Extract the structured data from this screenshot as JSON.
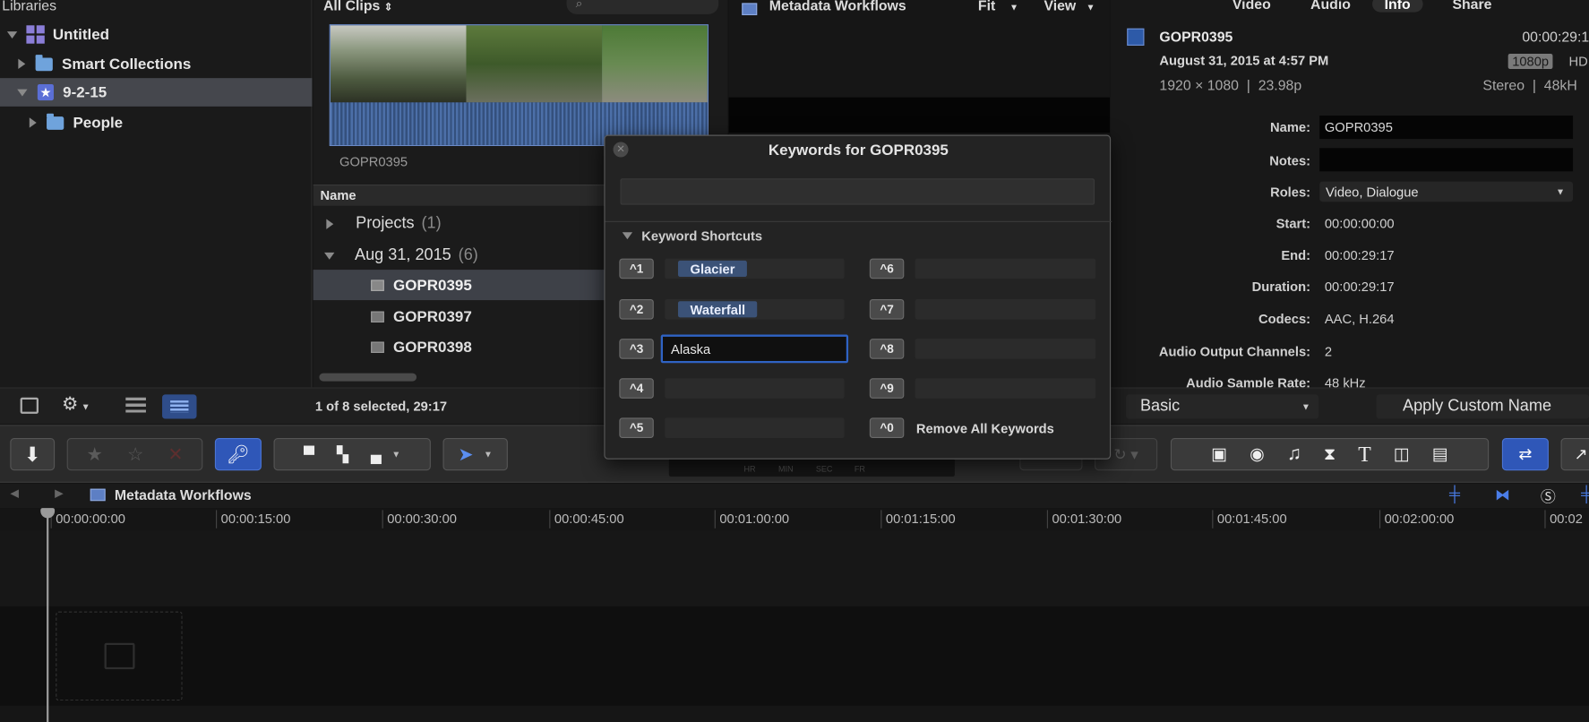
{
  "libraries": {
    "header": "Libraries",
    "items": [
      {
        "label": "Untitled"
      },
      {
        "label": "Smart Collections"
      },
      {
        "label": "9-2-15"
      },
      {
        "label": "People"
      }
    ]
  },
  "browser": {
    "filter": "All Clips",
    "filmstrip_label": "GOPR0395",
    "column_name": "Name",
    "rows": [
      {
        "label": "Projects",
        "count": "(1)"
      },
      {
        "label": "Aug 31, 2015",
        "count": "(6)"
      },
      {
        "label": "GOPR0395"
      },
      {
        "label": "GOPR0397"
      },
      {
        "label": "GOPR0398"
      }
    ],
    "status": "1 of 8 selected, 29:17"
  },
  "viewer": {
    "title": "Metadata Workflows",
    "fit": "Fit",
    "view": "View",
    "timecode_units": [
      "HR",
      "MIN",
      "SEC",
      "FR"
    ]
  },
  "inspector": {
    "tabs": [
      "Video",
      "Audio",
      "Info",
      "Share"
    ],
    "clip_name": "GOPR0395",
    "clip_date": "August 31, 2015 at 4:57 PM",
    "clip_duration": "00:00:29:1",
    "clip_format": "1920 × 1080  |  23.98p",
    "badge_res": "1080p",
    "badge_hd": "HD",
    "audio_info": "Stereo  |  48kH",
    "fields": [
      {
        "label": "Name:",
        "value": "GOPR0395"
      },
      {
        "label": "Notes:",
        "value": ""
      },
      {
        "label": "Roles:",
        "value": "Video, Dialogue"
      },
      {
        "label": "Start:",
        "value": "00:00:00:00"
      },
      {
        "label": "End:",
        "value": "00:00:29:17"
      },
      {
        "label": "Duration:",
        "value": "00:00:29:17"
      },
      {
        "label": "Codecs:",
        "value": "AAC, H.264"
      },
      {
        "label": "Audio Output Channels:",
        "value": "2"
      },
      {
        "label": "Audio Sample Rate:",
        "value": "48 kHz"
      }
    ],
    "metadata_view": "Basic",
    "apply_name": "Apply Custom Name"
  },
  "keywords_dialog": {
    "title": "Keywords for GOPR0395",
    "shortcuts_header": "Keyword Shortcuts",
    "shortcuts": [
      {
        "key": "^1",
        "keyword": "Glacier"
      },
      {
        "key": "^2",
        "keyword": "Waterfall"
      },
      {
        "key": "^3",
        "keyword": "Alaska"
      },
      {
        "key": "^4",
        "keyword": ""
      },
      {
        "key": "^5",
        "keyword": ""
      },
      {
        "key": "^6",
        "keyword": ""
      },
      {
        "key": "^7",
        "keyword": ""
      },
      {
        "key": "^8",
        "keyword": ""
      },
      {
        "key": "^9",
        "keyword": ""
      }
    ],
    "remove_key": "^0",
    "remove_label": "Remove All Keywords"
  },
  "timeline": {
    "title": "Metadata Workflows",
    "ruler": [
      "00:00:00:00",
      "00:00:15:00",
      "00:00:30:00",
      "00:00:45:00",
      "00:01:00:00",
      "00:01:15:00",
      "00:01:30:00",
      "00:01:45:00",
      "00:02:00:00",
      "00:02"
    ]
  },
  "colors": {
    "accent": "#3b6fd6",
    "selection": "#3e4148",
    "keyword_tag": "#3b5277",
    "panel_bg": "#141414"
  }
}
